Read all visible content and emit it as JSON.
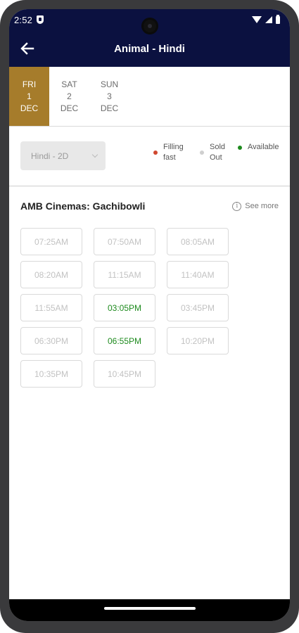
{
  "status_bar": {
    "time": "2:52"
  },
  "app_bar": {
    "title": "Animal - Hindi"
  },
  "dates": [
    {
      "day": "FRI",
      "date": "1",
      "month": "DEC",
      "selected": true
    },
    {
      "day": "SAT",
      "date": "2",
      "month": "DEC",
      "selected": false
    },
    {
      "day": "SUN",
      "date": "3",
      "month": "DEC",
      "selected": false
    }
  ],
  "filter": {
    "language_format": "Hindi - 2D"
  },
  "legend": [
    {
      "label": "Filling fast",
      "color": "#d0472f"
    },
    {
      "label": "Sold Out",
      "color": "#cfcfcf"
    },
    {
      "label": "Available",
      "color": "#1d8a1d"
    }
  ],
  "cinema": {
    "name": "AMB Cinemas: Gachibowli",
    "see_more_label": "See more",
    "showtimes": [
      {
        "time": "07:25AM",
        "status": "sold-out"
      },
      {
        "time": "07:50AM",
        "status": "sold-out"
      },
      {
        "time": "08:05AM",
        "status": "sold-out"
      },
      {
        "time": "08:20AM",
        "status": "sold-out"
      },
      {
        "time": "11:15AM",
        "status": "sold-out"
      },
      {
        "time": "11:40AM",
        "status": "sold-out"
      },
      {
        "time": "11:55AM",
        "status": "sold-out"
      },
      {
        "time": "03:05PM",
        "status": "available"
      },
      {
        "time": "03:45PM",
        "status": "sold-out"
      },
      {
        "time": "06:30PM",
        "status": "sold-out"
      },
      {
        "time": "06:55PM",
        "status": "available"
      },
      {
        "time": "10:20PM",
        "status": "sold-out"
      },
      {
        "time": "10:35PM",
        "status": "sold-out"
      },
      {
        "time": "10:45PM",
        "status": "sold-out"
      }
    ]
  },
  "colors": {
    "brand_navy": "#0b1140",
    "selected_date": "#a67c2b",
    "available_green": "#1d8a1d"
  }
}
